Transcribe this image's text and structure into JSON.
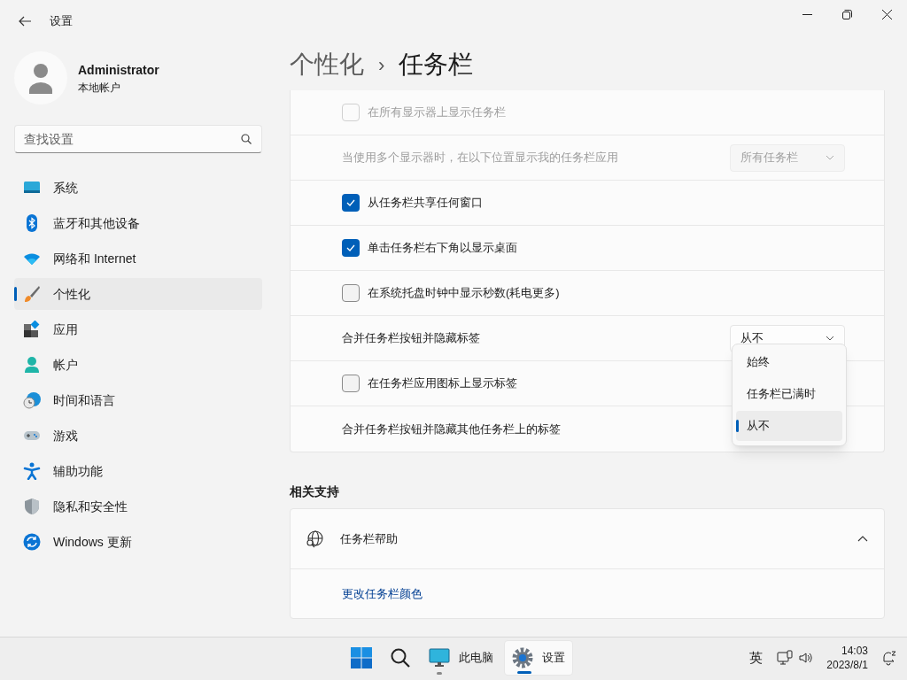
{
  "window": {
    "title": "设置"
  },
  "profile": {
    "name": "Administrator",
    "account": "本地帐户"
  },
  "search": {
    "placeholder": "查找设置"
  },
  "sidebar": {
    "items": [
      {
        "label": "系统",
        "selected": false
      },
      {
        "label": "蓝牙和其他设备",
        "selected": false
      },
      {
        "label": "网络和 Internet",
        "selected": false
      },
      {
        "label": "个性化",
        "selected": true
      },
      {
        "label": "应用",
        "selected": false
      },
      {
        "label": "帐户",
        "selected": false
      },
      {
        "label": "时间和语言",
        "selected": false
      },
      {
        "label": "游戏",
        "selected": false
      },
      {
        "label": "辅助功能",
        "selected": false
      },
      {
        "label": "隐私和安全性",
        "selected": false
      },
      {
        "label": "Windows 更新",
        "selected": false
      }
    ]
  },
  "breadcrumb": [
    "个性化",
    "›",
    "任务栏"
  ],
  "settings": [
    {
      "kind": "checkbox",
      "label": "在所有显示器上显示任务栏",
      "checked": false,
      "disabled": true
    },
    {
      "kind": "dropdown",
      "label": "当使用多个显示器时，在以下位置显示我的任务栏应用",
      "value": "所有任务栏",
      "disabled": true
    },
    {
      "kind": "checkbox",
      "label": "从任务栏共享任何窗口",
      "checked": true,
      "disabled": false
    },
    {
      "kind": "checkbox",
      "label": "单击任务栏右下角以显示桌面",
      "checked": true,
      "disabled": false
    },
    {
      "kind": "checkbox",
      "label": "在系统托盘时钟中显示秒数(耗电更多)",
      "checked": false,
      "disabled": false
    },
    {
      "kind": "dropdown",
      "label": "合并任务栏按钮并隐藏标签",
      "value": "从不",
      "disabled": false,
      "options": [
        {
          "label": "始终",
          "selected": false
        },
        {
          "label": "任务栏已满时",
          "selected": false
        },
        {
          "label": "从不",
          "selected": true
        }
      ]
    },
    {
      "kind": "checkbox",
      "label": "在任务栏应用图标上显示标签",
      "checked": false,
      "disabled": false
    },
    {
      "kind": "label",
      "label": "合并任务栏按钮并隐藏其他任务栏上的标签"
    }
  ],
  "related": {
    "heading": "相关支持",
    "title": "任务栏帮助",
    "expanded": true,
    "link": "更改任务栏颜色"
  },
  "taskbar": {
    "apps": [
      {
        "label": "此电脑",
        "active": false
      },
      {
        "label": "设置",
        "active": true
      }
    ],
    "ime": "英",
    "time": "14:03",
    "date": "2023/8/1"
  }
}
